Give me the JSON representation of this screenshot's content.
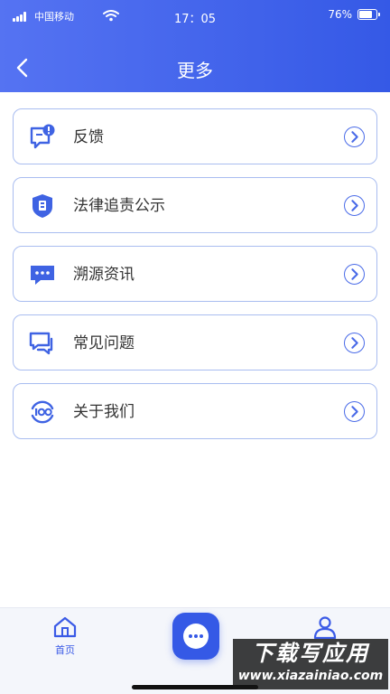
{
  "status_bar": {
    "carrier": "中国移动",
    "time": "17：05",
    "battery_percent": "76%",
    "battery_level": 0.76
  },
  "nav": {
    "title": "更多",
    "back_icon": "chevron-left-icon"
  },
  "menu": {
    "items": [
      {
        "label": "反馈",
        "icon": "feedback-icon"
      },
      {
        "label": "法律追责公示",
        "icon": "shield-icon"
      },
      {
        "label": "溯源资讯",
        "icon": "message-icon"
      },
      {
        "label": "常见问题",
        "icon": "chat-bubbles-icon"
      },
      {
        "label": "关于我们",
        "icon": "about-icon"
      }
    ]
  },
  "tabbar": {
    "home_label": "首页",
    "home_icon": "home-icon",
    "center_icon": "chat-dots-icon",
    "profile_icon": "user-icon"
  },
  "watermark": {
    "title": "下载写应用",
    "url": "www.xiazainiao.com"
  },
  "colors": {
    "primary": "#3559e6",
    "header_gradient_start": "#5573f2",
    "item_border": "#a9bdf0",
    "text": "#333333"
  }
}
